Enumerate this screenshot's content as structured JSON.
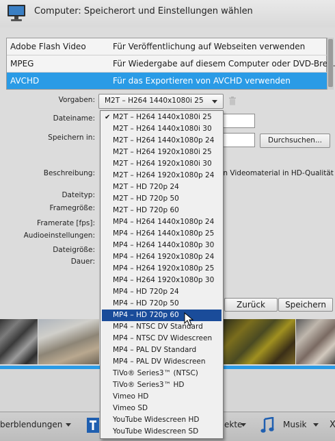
{
  "window": {
    "title": "Computer: Speicherort und Einstellungen wählen",
    "icon": "monitor-icon"
  },
  "formats": [
    {
      "name": "Adobe Flash Video",
      "desc": "Für Veröffentlichung auf Webseiten verwenden",
      "selected": false
    },
    {
      "name": "MPEG",
      "desc": "Für Wiedergabe auf diesem Computer oder DVD-Bren...",
      "selected": false
    },
    {
      "name": "AVCHD",
      "desc": "Für das Exportieren von AVCHD verwenden",
      "selected": true
    }
  ],
  "form": {
    "vorgaben_label": "Vorgaben:",
    "vorgaben_value": "M2T – H264 1440x1080i 25",
    "dateiname_label": "Dateiname:",
    "speichern_label": "Speichern in:",
    "durchsuchen": "Durchsuchen...",
    "beschreibung_label": "Beschreibung:",
    "beschreibung_text": "on Videomaterial in HD-Qualität",
    "dateityp_label": "Dateityp:",
    "framegroesse_label": "Framegröße:",
    "framerate_label": "Framerate [fps]:",
    "audio_label": "Audioeinstellungen:",
    "dateigroesse_label": "Dateigröße:",
    "dauer_label": "Dauer:",
    "zurueck": "Zurück",
    "speichern": "Speichern"
  },
  "dropdown": {
    "checked_index": 0,
    "highlighted_index": 17,
    "items": [
      "M2T – H264 1440x1080i 25",
      "M2T – H264 1440x1080i 30",
      "M2T – H264 1440x1080p 24",
      "M2T – H264 1920x1080i 25",
      "M2T – H264 1920x1080i 30",
      "M2T – H264 1920x1080p 24",
      "M2T – HD 720p 24",
      "M2T – HD 720p 50",
      "M2T – HD 720p 60",
      "MP4 – H264 1440x1080p 24",
      "MP4 – H264 1440x1080p 25",
      "MP4 – H264 1440x1080p 30",
      "MP4 – H264 1920x1080p 24",
      "MP4 – H264 1920x1080p 25",
      "MP4 – H264 1920x1080p 30",
      "MP4 – HD 720p 24",
      "MP4 – HD 720p 50",
      "MP4 – HD 720p 60",
      "MP4 – NTSC DV Standard",
      "MP4 – NTSC DV Widescreen",
      "MP4 – PAL DV Standard",
      "MP4 – PAL DV Widescreen",
      "TiVo® Series3™ (NTSC)",
      "TiVo® Series3™ HD",
      "Vimeo HD",
      "Vimeo SD",
      "YouTube Widescreen HD",
      "YouTube Widescreen SD"
    ]
  },
  "bottom": {
    "ueberblendungen": "berblendungen",
    "effekte": "ekte",
    "musik": "Musik",
    "close": "X"
  },
  "colors": {
    "selection_blue": "#2a9be6",
    "menu_highlight": "#1a4c9a"
  }
}
